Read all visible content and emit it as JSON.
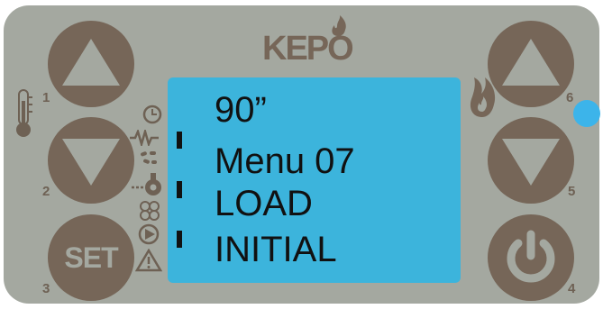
{
  "brand": {
    "name": "KEPO"
  },
  "buttons": [
    {
      "id": 1,
      "label": "1"
    },
    {
      "id": 2,
      "label": "2"
    },
    {
      "id": 3,
      "label": "3",
      "text": "SET"
    },
    {
      "id": 4,
      "label": "4"
    },
    {
      "id": 5,
      "label": "5"
    },
    {
      "id": 6,
      "label": "6"
    }
  ],
  "display": {
    "lines": [
      "90”",
      "Menu 07",
      "LOAD",
      "INITIAL"
    ],
    "background": "#3cb4dc"
  },
  "colors": {
    "panel": "#a4a8a0",
    "button": "#766658",
    "led": "#3cb4ea"
  },
  "icons": [
    "thermometer-icon",
    "clock-icon",
    "resistance-icon",
    "pellet-icon",
    "auger-icon",
    "fan-icon",
    "pump-icon",
    "warning-icon",
    "flame-icon",
    "led-indicator"
  ]
}
